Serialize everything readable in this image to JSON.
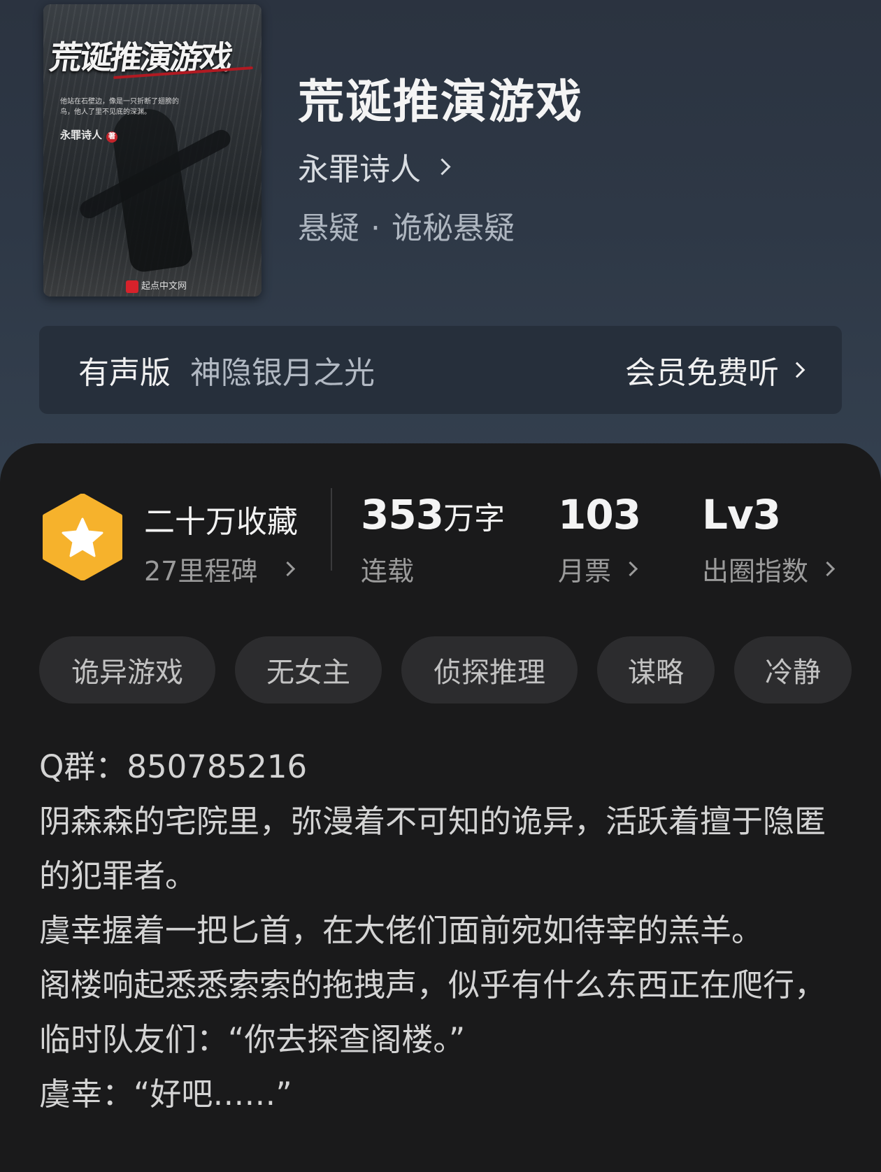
{
  "book": {
    "title": "荒诞推演游戏",
    "author": "永罪诗人",
    "category": "悬疑",
    "subcategory": "诡秘悬疑",
    "separator": "·"
  },
  "cover": {
    "title_text": "荒诞推演游戏",
    "blurb": "他站在石壁边，像是一只折断了翅膀的鸟，他人了里不见底的深渊。",
    "author_text": "永罪诗人",
    "author_mark": "著",
    "publisher": "起点中文网"
  },
  "audio": {
    "label": "有声版",
    "name": "神隐银月之光",
    "action": "会员免费听"
  },
  "stats": {
    "collection_title": "二十万收藏",
    "collection_sub": "27里程碑",
    "words_num": "353",
    "words_unit": "万字",
    "words_sub": "连载",
    "tickets_num": "103",
    "tickets_sub": "月票",
    "level_num": "Lv3",
    "level_sub": "出圈指数"
  },
  "tags": [
    "诡异游戏",
    "无女主",
    "侦探推理",
    "谋略",
    "冷静"
  ],
  "intro": [
    "Q群：850785216",
    "阴森森的宅院里，弥漫着不可知的诡异，活跃着擅于隐匿的犯罪者。",
    "虞幸握着一把匕首，在大佬们面前宛如待宰的羔羊。",
    "阁楼响起悉悉索索的拖拽声，似乎有什么东西正在爬行，临时队友们：“你去探查阁楼。”",
    "虞幸：“好吧……”"
  ],
  "colors": {
    "badge": "#f6b22c",
    "hero_bg": "#2e3846",
    "panel_bg": "#1a1a1b",
    "tag_bg": "#2c2c2e"
  }
}
